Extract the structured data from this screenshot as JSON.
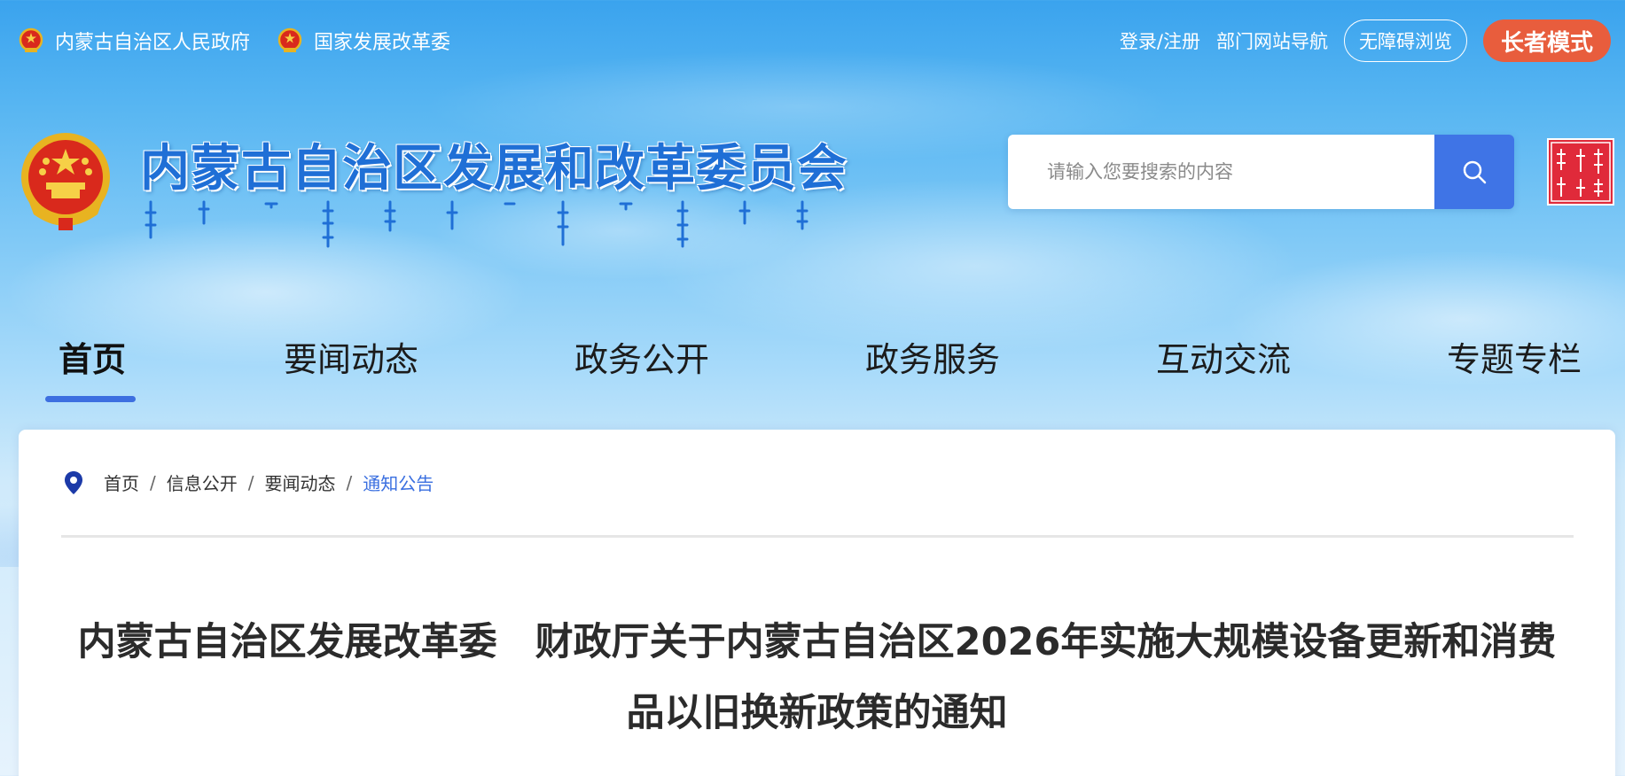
{
  "topbar": {
    "left_links": [
      "内蒙古自治区人民政府",
      "国家发展改革委"
    ],
    "login": "登录/注册",
    "dept_nav": "部门网站导航",
    "accessible": "无障碍浏览",
    "elder_mode": "长者模式"
  },
  "header": {
    "site_title": "内蒙古自治区发展和改革委员会",
    "search_placeholder": "请输入您要搜索的内容",
    "seal_text": "内蒙古"
  },
  "nav": {
    "items": [
      "首页",
      "要闻动态",
      "政务公开",
      "政务服务",
      "互动交流",
      "专题专栏"
    ]
  },
  "breadcrumb": {
    "items": [
      "首页",
      "信息公开",
      "要闻动态",
      "通知公告"
    ]
  },
  "article": {
    "title": "内蒙古自治区发展改革委　财政厅关于内蒙古自治区2026年实施大规模设备更新和消费品以旧换新政策的通知"
  },
  "colors": {
    "accent": "#3f74e6",
    "elder_button": "#e85d3d",
    "breadcrumb_current": "#3a6fe0"
  }
}
